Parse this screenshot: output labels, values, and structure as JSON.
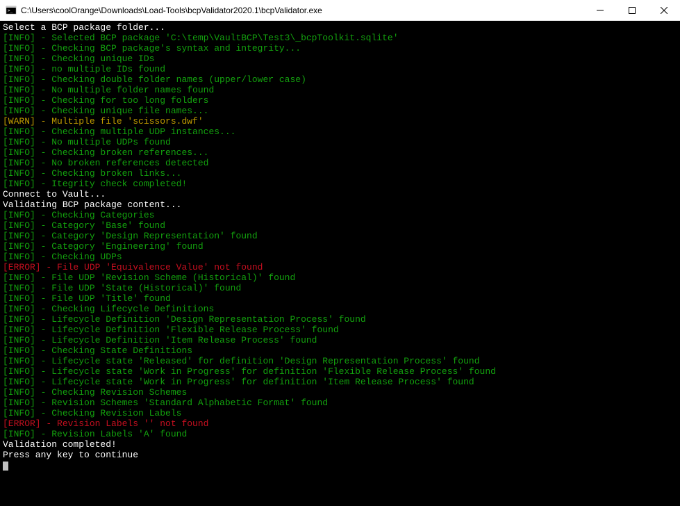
{
  "window": {
    "title": "C:\\Users\\coolOrange\\Downloads\\Load-Tools\\bcpValidator2020.1\\bcpValidator.exe"
  },
  "lines": [
    {
      "cls": "white",
      "text": "Select a BCP package folder..."
    },
    {
      "cls": "green",
      "text": "[INFO] - Selected BCP package 'C:\\temp\\VaultBCP\\Test3\\_bcpToolkit.sqlite'"
    },
    {
      "cls": "green",
      "text": "[INFO] - Checking BCP package's syntax and integrity..."
    },
    {
      "cls": "green",
      "text": "[INFO] - Checking unique IDs"
    },
    {
      "cls": "green",
      "text": "[INFO] - no multiple IDs found"
    },
    {
      "cls": "green",
      "text": "[INFO] - Checking double folder names (upper/lower case)"
    },
    {
      "cls": "green",
      "text": "[INFO] - No multiple folder names found"
    },
    {
      "cls": "green",
      "text": "[INFO] - Checking for too long folders"
    },
    {
      "cls": "green",
      "text": "[INFO] - Checking unique file names..."
    },
    {
      "cls": "yellow",
      "text": "[WARN] - Multiple file 'scissors.dwf'"
    },
    {
      "cls": "green",
      "text": "[INFO] - Checking multiple UDP instances..."
    },
    {
      "cls": "green",
      "text": "[INFO] - No multiple UDPs found"
    },
    {
      "cls": "green",
      "text": "[INFO] - Checking broken references..."
    },
    {
      "cls": "green",
      "text": "[INFO] - No broken references detected"
    },
    {
      "cls": "green",
      "text": "[INFO] - Checking broken links..."
    },
    {
      "cls": "green",
      "text": "[INFO] - Itegrity check completed!"
    },
    {
      "cls": "white",
      "text": "Connect to Vault..."
    },
    {
      "cls": "white",
      "text": "Validating BCP package content..."
    },
    {
      "cls": "green",
      "text": "[INFO] - Checking Categories"
    },
    {
      "cls": "green",
      "text": "[INFO] - Category 'Base' found"
    },
    {
      "cls": "green",
      "text": "[INFO] - Category 'Design Representation' found"
    },
    {
      "cls": "green",
      "text": "[INFO] - Category 'Engineering' found"
    },
    {
      "cls": "green",
      "text": "[INFO] - Checking UDPs"
    },
    {
      "cls": "red",
      "text": "[ERROR] - File UDP 'Equivalence Value' not found"
    },
    {
      "cls": "green",
      "text": "[INFO] - File UDP 'Revision Scheme (Historical)' found"
    },
    {
      "cls": "green",
      "text": "[INFO] - File UDP 'State (Historical)' found"
    },
    {
      "cls": "green",
      "text": "[INFO] - File UDP 'Title' found"
    },
    {
      "cls": "green",
      "text": "[INFO] - Checking Lifecycle Definitions"
    },
    {
      "cls": "green",
      "text": "[INFO] - Lifecycle Definition 'Design Representation Process' found"
    },
    {
      "cls": "green",
      "text": "[INFO] - Lifecycle Definition 'Flexible Release Process' found"
    },
    {
      "cls": "green",
      "text": "[INFO] - Lifecycle Definition 'Item Release Process' found"
    },
    {
      "cls": "green",
      "text": "[INFO] - Checking State Definitions"
    },
    {
      "cls": "green",
      "text": "[INFO] - Lifecycle state 'Released' for definition 'Design Representation Process' found"
    },
    {
      "cls": "green",
      "text": "[INFO] - Lifecycle state 'Work in Progress' for definition 'Flexible Release Process' found"
    },
    {
      "cls": "green",
      "text": "[INFO] - Lifecycle state 'Work in Progress' for definition 'Item Release Process' found"
    },
    {
      "cls": "green",
      "text": "[INFO] - Checking Revision Schemes"
    },
    {
      "cls": "green",
      "text": "[INFO] - Revision Schemes 'Standard Alphabetic Format' found"
    },
    {
      "cls": "green",
      "text": "[INFO] - Checking Revision Labels"
    },
    {
      "cls": "red",
      "text": "[ERROR] - Revision Labels '' not found"
    },
    {
      "cls": "green",
      "text": "[INFO] - Revision Labels 'A' found"
    },
    {
      "cls": "white",
      "text": "Validation completed!"
    },
    {
      "cls": "white",
      "text": "Press any key to continue"
    }
  ]
}
